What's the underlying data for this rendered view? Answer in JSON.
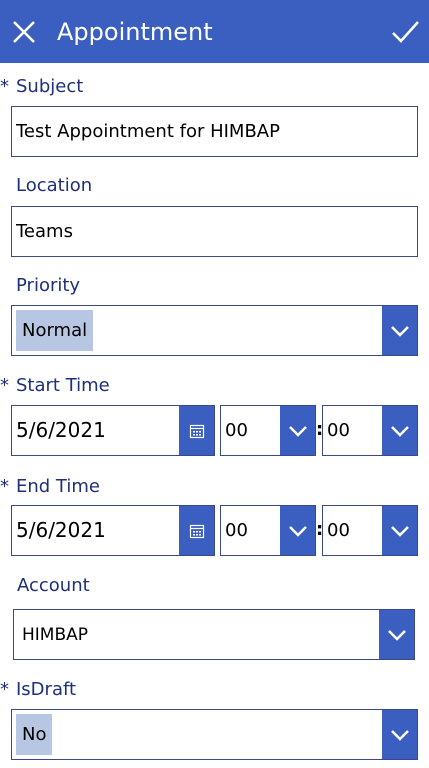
{
  "header": {
    "title": "Appointment"
  },
  "required_marker": "*",
  "subject": {
    "label": "Subject",
    "value": "Test Appointment for HIMBAP"
  },
  "location": {
    "label": "Location",
    "value": "Teams"
  },
  "priority": {
    "label": "Priority",
    "value": "Normal"
  },
  "start_time": {
    "label": "Start Time",
    "date": "5/6/2021",
    "hour": "00",
    "minute": "00",
    "separator": ":"
  },
  "end_time": {
    "label": "End Time",
    "date": "5/6/2021",
    "hour": "00",
    "minute": "00",
    "separator": ":"
  },
  "account": {
    "label": "Account",
    "value": "HIMBAP"
  },
  "is_draft": {
    "label": "IsDraft",
    "value": "No"
  },
  "colors": {
    "accent": "#3b5fc0",
    "label": "#1f2f78",
    "border": "#3b4a86",
    "highlight": "#b7c6e2"
  }
}
